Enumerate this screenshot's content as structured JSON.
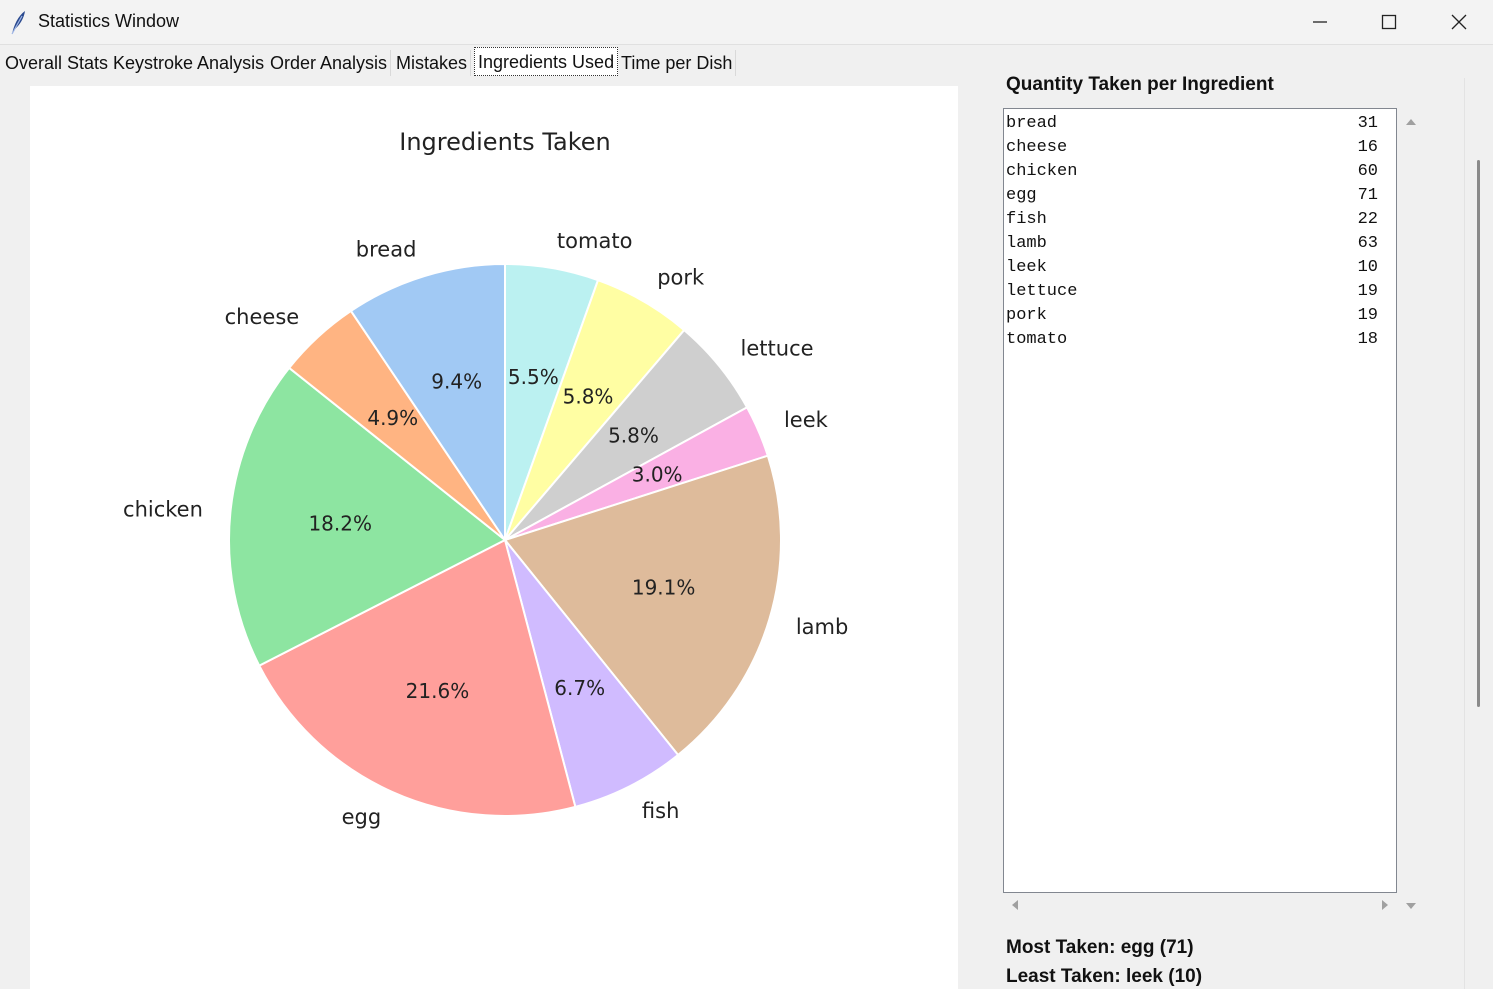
{
  "window": {
    "title": "Statistics Window",
    "icon": "feather-icon",
    "controls": [
      "minimize-icon",
      "maximize-icon",
      "close-icon"
    ]
  },
  "tabs": [
    {
      "label": "Overall Stats",
      "active": false
    },
    {
      "label": "Keystroke Analysis",
      "active": false
    },
    {
      "label": "Order Analysis",
      "active": false
    },
    {
      "label": "Mistakes",
      "active": false
    },
    {
      "label": "Ingredients Used",
      "active": true
    },
    {
      "label": "Time per Dish",
      "active": false
    }
  ],
  "chart_data": {
    "type": "pie",
    "title": "Ingredients Taken",
    "start_angle_deg": 90,
    "direction": "clockwise",
    "slices": [
      {
        "label": "tomato",
        "value": 18,
        "pct_label": "5.5%",
        "color": "#bbf1f1"
      },
      {
        "label": "pork",
        "value": 19,
        "pct_label": "5.8%",
        "color": "#fffea3"
      },
      {
        "label": "lettuce",
        "value": 19,
        "pct_label": "5.8%",
        "color": "#cfcfcf"
      },
      {
        "label": "leek",
        "value": 10,
        "pct_label": "3.0%",
        "color": "#fab0e4"
      },
      {
        "label": "lamb",
        "value": 63,
        "pct_label": "19.1%",
        "color": "#debb9b"
      },
      {
        "label": "fish",
        "value": 22,
        "pct_label": "6.7%",
        "color": "#d0bbff"
      },
      {
        "label": "egg",
        "value": 71,
        "pct_label": "21.6%",
        "color": "#ff9f9b"
      },
      {
        "label": "chicken",
        "value": 60,
        "pct_label": "18.2%",
        "color": "#8de5a1"
      },
      {
        "label": "cheese",
        "value": 16,
        "pct_label": "4.9%",
        "color": "#ffb482"
      },
      {
        "label": "bread",
        "value": 31,
        "pct_label": "9.4%",
        "color": "#a1c9f4"
      }
    ]
  },
  "sidebar": {
    "heading": "Quantity Taken per Ingredient",
    "rows": [
      {
        "name": "bread",
        "qty": "31"
      },
      {
        "name": "cheese",
        "qty": "16"
      },
      {
        "name": "chicken",
        "qty": "60"
      },
      {
        "name": "egg",
        "qty": "71"
      },
      {
        "name": "fish",
        "qty": "22"
      },
      {
        "name": "lamb",
        "qty": "63"
      },
      {
        "name": "leek",
        "qty": "10"
      },
      {
        "name": "lettuce",
        "qty": "19"
      },
      {
        "name": "pork",
        "qty": "19"
      },
      {
        "name": "tomato",
        "qty": "18"
      }
    ],
    "most_taken": "Most Taken: egg (71)",
    "least_taken": "Least Taken: leek (10)"
  }
}
